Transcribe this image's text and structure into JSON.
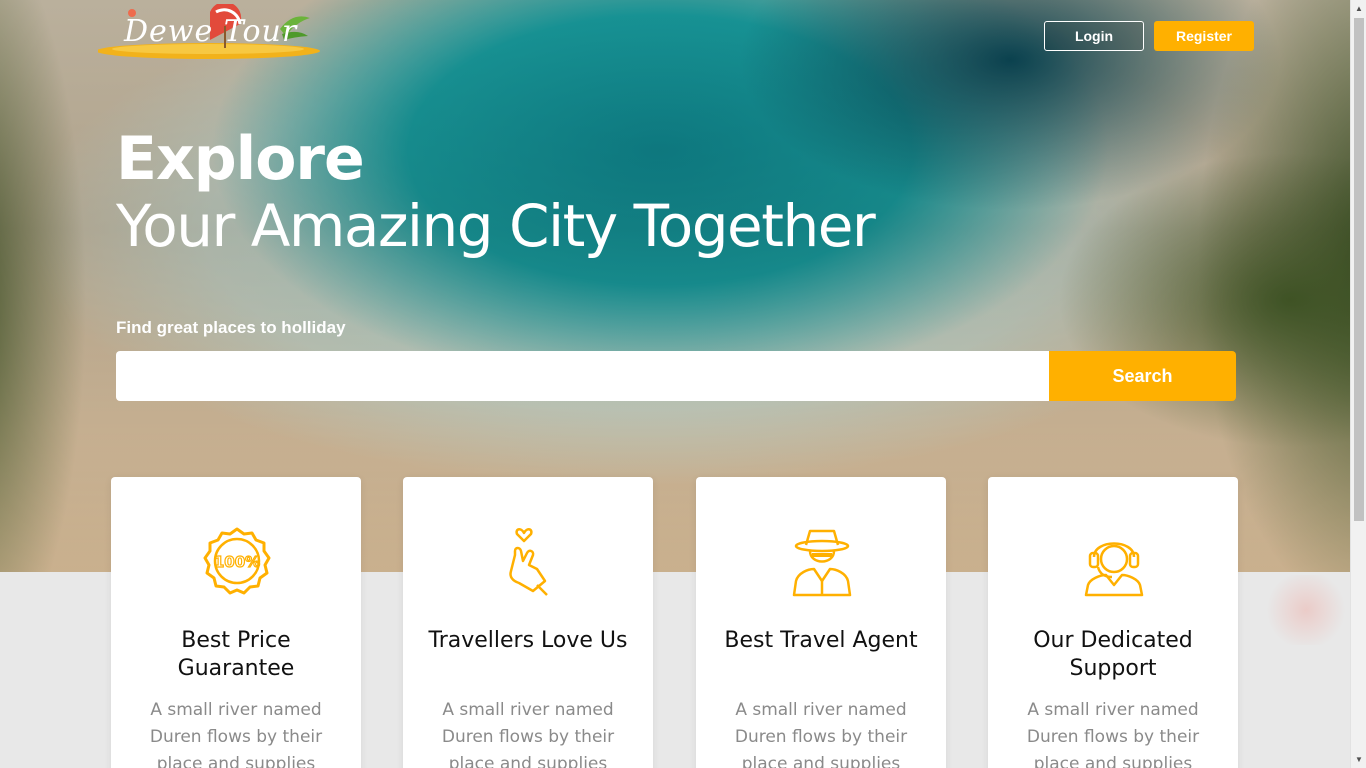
{
  "brand": {
    "logo_text": "Dewe Tour"
  },
  "nav": {
    "login_label": "Login",
    "register_label": "Register"
  },
  "hero": {
    "title": "Explore",
    "subtitle": "Your Amazing City Together",
    "find_label": "Find great places to holliday"
  },
  "search": {
    "value": "",
    "placeholder": "",
    "button_label": "Search"
  },
  "features": [
    {
      "icon": "price-guarantee-badge-icon",
      "title": "Best Price Guarantee",
      "description": "A small river named Duren flows by their place and supplies"
    },
    {
      "icon": "finger-heart-icon",
      "title": "Travellers Love Us",
      "description": "A small river named Duren flows by their place and supplies"
    },
    {
      "icon": "travel-agent-icon",
      "title": "Best Travel Agent",
      "description": "A small river named Duren flows by their place and supplies"
    },
    {
      "icon": "support-headset-icon",
      "title": "Our Dedicated Support",
      "description": "A small river named Duren flows by their place and supplies"
    }
  ],
  "colors": {
    "accent": "#ffb000",
    "page_background": "#e8e8e8",
    "card_background": "#ffffff",
    "muted_text": "#8a8a8a"
  }
}
